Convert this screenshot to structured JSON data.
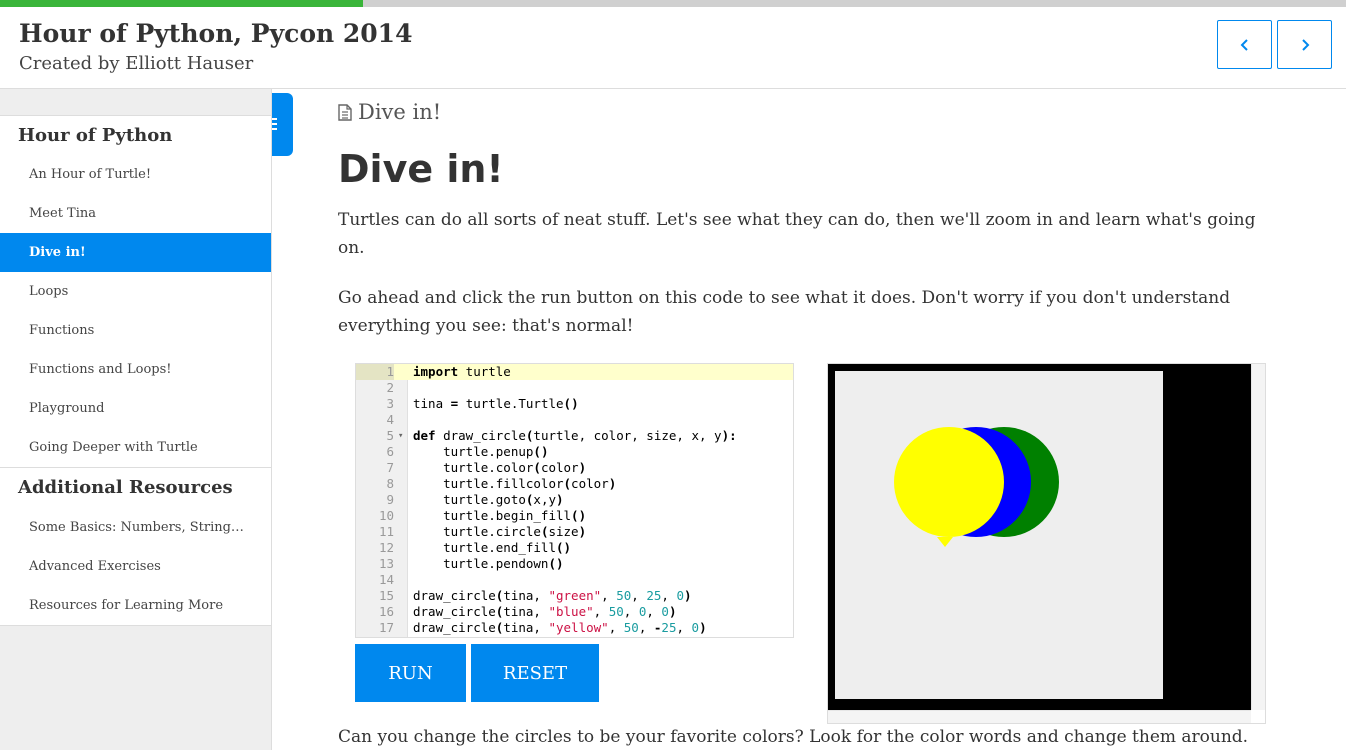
{
  "progress": {
    "percent": 27
  },
  "header": {
    "title": "Hour of Python, Pycon 2014",
    "author": "Created by Elliott Hauser",
    "prev_icon": "chevron-left-icon",
    "next_icon": "chevron-right-icon"
  },
  "sidebar": {
    "sections": [
      {
        "title": "Hour of Python",
        "items": [
          {
            "label": "An Hour of Turtle!"
          },
          {
            "label": "Meet Tina"
          },
          {
            "label": "Dive in!",
            "active": true
          },
          {
            "label": "Loops"
          },
          {
            "label": "Functions"
          },
          {
            "label": "Functions and Loops!"
          },
          {
            "label": "Playground"
          },
          {
            "label": "Going Deeper with Turtle"
          }
        ]
      },
      {
        "title": "Additional Resources",
        "items": [
          {
            "label": "Some Basics: Numbers, Strings, and Other Types"
          },
          {
            "label": "Advanced Exercises"
          },
          {
            "label": "Resources for Learning More"
          }
        ]
      }
    ]
  },
  "page": {
    "breadcrumb": "Dive in!",
    "title": "Dive in!",
    "paragraph1": "Turtles can do all sorts of neat stuff. Let's see what they can do, then we'll zoom in and learn what's going on.",
    "paragraph2": "Go ahead and click the run button on this code to see what it does. Don't worry if you don't understand everything you see: that's normal!",
    "paragraph3": "Can you change the circles to be your favorite colors? Look for the color words and change them around."
  },
  "editor": {
    "lines": [
      "import turtle",
      "",
      "tina = turtle.Turtle()",
      "",
      "def draw_circle(turtle, color, size, x, y):",
      "    turtle.penup()",
      "    turtle.color(color)",
      "    turtle.fillcolor(color)",
      "    turtle.goto(x,y)",
      "    turtle.begin_fill()",
      "    turtle.circle(size)",
      "    turtle.end_fill()",
      "    turtle.pendown()",
      "",
      "draw_circle(tina, \"green\", 50, 25, 0)",
      "draw_circle(tina, \"blue\", 50, 0, 0)",
      "draw_circle(tina, \"yellow\", 50, -25, 0)"
    ],
    "run_label": "RUN",
    "reset_label": "RESET"
  },
  "turtle_output": {
    "circles": [
      {
        "color": "#008000",
        "size": 50,
        "x": 25,
        "y": 0
      },
      {
        "color": "#0000ff",
        "size": 50,
        "x": 0,
        "y": 0
      },
      {
        "color": "#ffff00",
        "size": 50,
        "x": -25,
        "y": 0
      }
    ]
  },
  "colors": {
    "accent": "#0088ee",
    "progress": "#3ab53a"
  }
}
